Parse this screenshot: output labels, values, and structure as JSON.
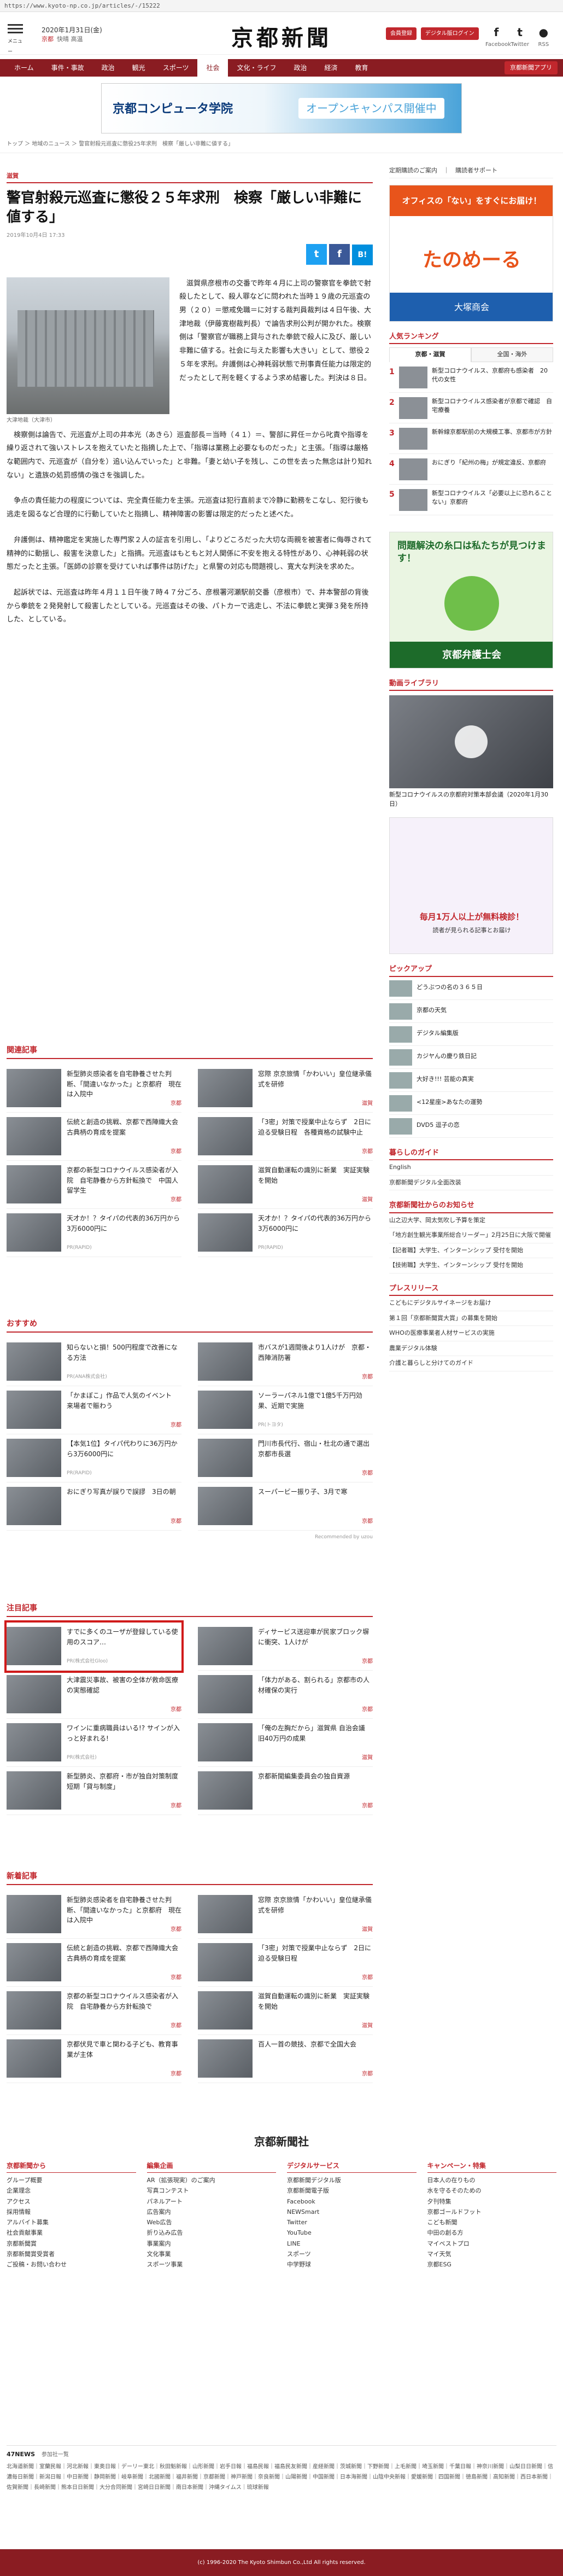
{
  "url": "https://www.kyoto-np.co.jp/articles/-/15222",
  "header": {
    "menu_label": "メニュー",
    "date": "2020年1月31日(金)",
    "weather": [
      "京都",
      "快晴",
      "高温"
    ],
    "logo": "京都新聞",
    "btn_member": "会員登録",
    "btn_digital": "デジタル版ログイン",
    "social": [
      {
        "icon": "f",
        "label": "Facebook"
      },
      {
        "icon": "t",
        "label": "Twitter"
      },
      {
        "icon": "●",
        "label": "RSS"
      }
    ]
  },
  "nav": {
    "items": [
      "ホーム",
      "事件・事故",
      "政治",
      "観光",
      "スポーツ",
      "社会",
      "文化・ライフ",
      "政治",
      "経済",
      "教育"
    ],
    "active": 5,
    "capsule": "京都新聞アプリ"
  },
  "banner_top": {
    "left": "京都コンピュータ学院",
    "right": "オープンキャンパス開催中"
  },
  "breadcrumb": "トップ ＞ 地域のニュース ＞ 警官射殺元巡査に懲役25年求刑　検察「厳しい非難に値する」",
  "article": {
    "category": "滋賀",
    "title": "警官射殺元巡査に懲役２５年求刑　検察「厳しい非難に値する」",
    "date": "2019年10月4日 17:33",
    "share": [
      "t",
      "f",
      "B!"
    ],
    "photo_caption": "大津地裁（大津市）",
    "paragraphs": [
      "滋賀県彦根市の交番で昨年４月に上司の警察官を拳銃で射殺したとして、殺人罪などに問われた当時１９歳の元巡査の男（２０）＝懲戒免職＝に対する裁判員裁判は４日午後、大津地裁（伊藤寛樹裁判長）で論告求刑公判が開かれた。検察側は「警察官が職務上貸与された拳銃で殺人に及び、厳しい非難に値する。社会に与えた影響も大きい」として、懲役２５年を求刑。弁護側は心神耗弱状態で刑事責任能力は限定的だったとして刑を軽くするよう求め結審した。判決は８日。",
      "検察側は論告で、元巡査が上司の井本光（あきら）巡査部長＝当時（４１）＝、警部に昇任＝から叱責や指導を繰り返されて強いストレスを抱えていたと指摘した上で、「指導は業務上必要なものだった」と主張。「指導は厳格な範囲内で、元巡査が（自分を）追い込んでいった」と非難。「妻と幼い子を残し、この世を去った無念は計り知れない」と遺族の処罰感情の強さを強調した。",
      "争点の責任能力の程度については、完全責任能力を主張。元巡査は犯行直前まで冷静に勤務をこなし、犯行後も逃走を図るなど合理的に行動していたと指摘し、精神障害の影響は限定的だったと述べた。",
      "弁護側は、精神鑑定を実施した専門家２人の証言を引用し、「よりどころだった大切な両親を被害者に侮辱されて精神的に動揺し、殺害を決意した」と指摘。元巡査はもともと対人関係に不安を抱える特性があり、心神耗弱の状態だったと主張。「医師の診察を受けていれば事件は防げた」と県警の対応も問題視し、寛大な判決を求めた。",
      "起訴状では、元巡査は昨年４月１１日午後７時４７分ごろ、彦根署河瀬駅前交番（彦根市）で、井本警部の背後から拳銃を２発発射して殺害したとしている。元巡査はその後、パトカーで逃走し、不法に拳銃と実弾３発を所持した、としている。"
    ]
  },
  "related": {
    "title": "関連記事",
    "items": [
      {
        "text": "新型肺炎感染者を自宅静養させた判断、「間違いなかった」と京都府　現在は入院中",
        "tag": "京都"
      },
      {
        "text": "窓際 京京旅情「かわいい」皇位継承儀式を研修",
        "tag": "滋賀"
      },
      {
        "text": "伝統と創造の挑戦、京都で西陣織大会　古典柄の育成を提案",
        "tag": "京都"
      },
      {
        "text": "「3密」対策で授業中止ならず　2日に迫る受験日程　各種資格の試験中止",
        "tag": "京都"
      },
      {
        "text": "京都の新型コロナウイルス感染者が入院　自宅静養から方針転換で　中国人留学生",
        "tag": "京都"
      },
      {
        "text": "滋賀自動運転の識別に新業　実証実験を開始",
        "tag": "滋賀"
      },
      {
        "text": "天才か！？タイパの代表的36万円から3万6000円に",
        "pr": "PR(RAPID)"
      },
      {
        "text": "天才か！？タイパの代表的36万円から3万6000円に",
        "pr": "PR(RAPID)"
      }
    ]
  },
  "recommend": {
    "title": "おすすめ",
    "items": [
      {
        "text": "知らないと損！500円程度で改善になる方法",
        "pr": "PR(ANA株式会社)"
      },
      {
        "text": "市バスが1週間後より1人けが　京都・西陣消防署",
        "tag": "京都"
      },
      {
        "text": "「かまぼこ」作品で人気のイベント　来場者で賑わう",
        "tag": "京都"
      },
      {
        "text": "ソーラーパネル1億で1億5千万円効果、近期で実施",
        "pr": "PR(トヨタ)"
      },
      {
        "text": "【本気1位】タイパ代わりに36万円から3万6000円に",
        "pr": "PR(RAPID)"
      },
      {
        "text": "門川市長代行、宿山・杜北の通で選出　京都市長選",
        "tag": "京都"
      },
      {
        "text": "おにぎり写真が誤りで誤謬　3日の朝",
        "tag": "京都"
      },
      {
        "text": "スーパービー振り子、3月で寒",
        "tag": "京都"
      }
    ],
    "uzou": "Recommended by uzou"
  },
  "featured": {
    "title": "注目記事",
    "items": [
      {
        "text": "すでに多くのユーザが登録している使用のスコア…",
        "pr": "PR(株式会社Gloo)"
      },
      {
        "text": "ディサービス送迎車が民家ブロック塀に衝突、1人けが",
        "tag": "京都"
      },
      {
        "text": "大津震災事故、被害の全体が救命医療の実態確認",
        "tag": "京都"
      },
      {
        "text": "「体力がある、割られる」京都市の人材確保の実行",
        "tag": "京都"
      },
      {
        "text": "ワインに重病職員はいる!? サインが入っと好まれる!",
        "pr": "PR(株式会社)"
      },
      {
        "text": "「俺の左胸だから」滋賀県 自治会議　旧40万円の成果",
        "tag": "滋賀"
      },
      {
        "text": "新型肺炎、京都府・市が独自対策制度　短期「貸与制度」",
        "tag": "京都"
      },
      {
        "text": "京都新聞編集委員会の独自資源",
        "tag": "京都"
      }
    ]
  },
  "latest": {
    "title": "新着記事",
    "items": [
      {
        "text": "新型肺炎感染者を自宅静養させた判断、「間違いなかった」と京都府　現在は入院中",
        "tag": "京都"
      },
      {
        "text": "窓際 京京旅情「かわいい」皇位継承儀式を研修",
        "tag": "滋賀"
      },
      {
        "text": "伝統と創造の挑戦、京都で西陣織大会　古典柄の育成を提案",
        "tag": "京都"
      },
      {
        "text": "「3密」対策で授業中止ならず　2日に迫る受験日程",
        "tag": "京都"
      },
      {
        "text": "京都の新型コロナウイルス感染者が入院　自宅静養から方針転換で",
        "tag": "京都"
      },
      {
        "text": "滋賀自動運転の識別に新業　実証実験を開始",
        "tag": "滋賀"
      },
      {
        "text": "京都伏見で車と関わる子ども、教育事業が主体",
        "tag": "京都"
      },
      {
        "text": "百人一首の競技、京都で全国大会",
        "tag": "京都"
      }
    ]
  },
  "sidebar": {
    "links": "定期購読のご案内　｜　購読者サポート",
    "ad1": {
      "top": "オフィスの「ない」をすぐにお届け！",
      "brand": "たのめーる",
      "sub": "大塚商会"
    },
    "ranking_title": "人気ランキング",
    "ranking_tabs": [
      "京都・滋賀",
      "全国・海外"
    ],
    "ranking": [
      "新型コロナウイルス、京都府も感染者　20代の女性",
      "新型コロナウイルス感染者が京都で確認　自宅療養",
      "新幹線京都駅前の大規模工事、京都市が方針",
      "おにぎり「紀州の梅」が規定違反、京都府",
      "新型コロナウイルス「必要以上に恐れることない」京都府"
    ],
    "ad2": {
      "top": "問題解決の糸口は私たちが見つけます！",
      "brand": "京都弁護士会"
    },
    "video_title": "動画ライブラリ",
    "video_caption": "新型コロナウイルスの京都府対策本部会議（2020年1月30日）",
    "ad3": {
      "top": "毎月1万人以上が無料検診！",
      "sub": "読者が見られる記事とお届け"
    },
    "pickup_title": "ピックアップ",
    "pickup": [
      "どうぶつの名の３６５日",
      "京都の天気",
      "デジタル編集版",
      "カジヤんの慶り鉄日記",
      "大好き!!! 芸能の真実",
      "<12星座>あなたの運勢",
      "DVD5 逗子の恋"
    ],
    "life_title": "暮らしのガイド",
    "life": [
      "English",
      "京都新聞デジタル全面改装"
    ],
    "notice_title": "京都新聞社からのお知らせ",
    "notice": [
      "山之辺大学、岡太気吹し予算を策定",
      "「地方創生観光事業所総合リーダー」2月25日に大阪で開催",
      "【記者職】大学生、インターンシップ 受付を開始",
      "【技術職】大学生、インターンシップ 受付を開始"
    ],
    "press_title": "プレスリリース",
    "press": [
      "こどもにデジタルサイネージをお届け",
      "第１回「京都新聞賞大賞」の募集を開始",
      "WHOの医療事業者人材サービスの実施",
      "農業デジタル体験",
      "介護と暮らしと分けてのガイド"
    ]
  },
  "footer": {
    "brand": "京都新聞社",
    "cols": [
      {
        "title": "京都新聞から",
        "items": [
          "グループ概要",
          "企業理念",
          "アクセス",
          "採用情報",
          "アルバイト募集",
          "社会貢献事業",
          "京都新聞賞",
          "京都新聞賞受賞者",
          "ご投稿・お問い合わせ"
        ]
      },
      {
        "title": "編集企画",
        "items": [
          "AR（拡張現実）のご案内",
          "写真コンテスト",
          "パネルアート",
          "広告案内",
          "Web広告",
          "折り込み広告",
          "事業案内",
          "文化事業",
          "スポーツ事業"
        ]
      },
      {
        "title": "デジタルサービス",
        "items": [
          "京都新聞デジタル版",
          "京都新聞電子版",
          "Facebook",
          "NEWSmart",
          "Twitter",
          "YouTube",
          "LINE",
          "スポーツ",
          "中学野球"
        ]
      },
      {
        "title": "キャンペーン・特集",
        "items": [
          "日本人の在りもの",
          "水を守るそのための",
          "夕刊特集",
          "京都ゴールドフット",
          "こども新聞",
          "中田の創る方",
          "マイベストプロ",
          "マイ天気",
          "京都ESG"
        ]
      }
    ]
  },
  "news47": {
    "title": "47NEWS",
    "link": "参加社一覧",
    "list": "北海道新聞｜室蘭民報｜河北新報｜東奥日報｜デーリー東北｜秋田魁新報｜山形新聞｜岩手日報｜福島民報｜福島民友新聞｜産経新聞｜茨城新聞｜下野新聞｜上毛新聞｜埼玉新聞｜千葉日報｜神奈川新聞｜山梨日日新聞｜信濃毎日新聞｜新潟日報｜中日新聞｜静岡新聞｜岐阜新聞｜北國新聞｜福井新聞｜京都新聞｜神戸新聞｜奈良新聞｜山陽新聞｜中国新聞｜日本海新聞｜山陰中央新報｜愛媛新聞｜四国新聞｜徳島新聞｜高知新聞｜西日本新聞｜佐賀新聞｜長崎新聞｜熊本日日新聞｜大分合同新聞｜宮崎日日新聞｜南日本新聞｜沖縄タイムス｜琉球新報"
  },
  "copyright": "(c) 1996-2020 The Kyoto Shimbun Co.,Ltd All rights reserved."
}
